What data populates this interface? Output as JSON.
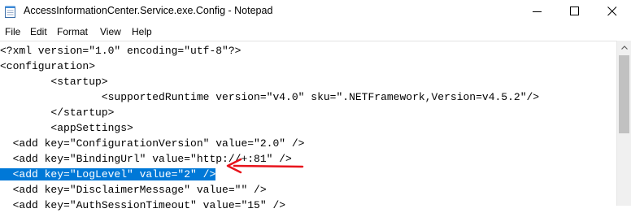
{
  "window": {
    "title": "AccessInformationCenter.Service.exe.Config - Notepad",
    "icon": "notepad-icon"
  },
  "controls": {
    "minimize": "minimize-icon",
    "maximize": "maximize-icon",
    "close": "close-icon"
  },
  "menu": {
    "items": [
      "File",
      "Edit",
      "Format",
      "View",
      "Help"
    ]
  },
  "editor": {
    "lines": [
      "<?xml version=\"1.0\" encoding=\"utf-8\"?>",
      "<configuration>",
      "        <startup>",
      "                <supportedRuntime version=\"v4.0\" sku=\".NETFramework,Version=v4.5.2\"/>",
      "        </startup>",
      "        <appSettings>",
      "  <add key=\"ConfigurationVersion\" value=\"2.0\" />",
      "  <add key=\"BindingUrl\" value=\"http://+:81\" />",
      "  <add key=\"LogLevel\" value=\"2\" />",
      "  <add key=\"DisclaimerMessage\" value=\"\" />",
      "  <add key=\"AuthSessionTimeout\" value=\"15\" />"
    ],
    "selected_line_index": 8,
    "selection_color": "#0078d7",
    "annotation_color": "#e8141c"
  }
}
